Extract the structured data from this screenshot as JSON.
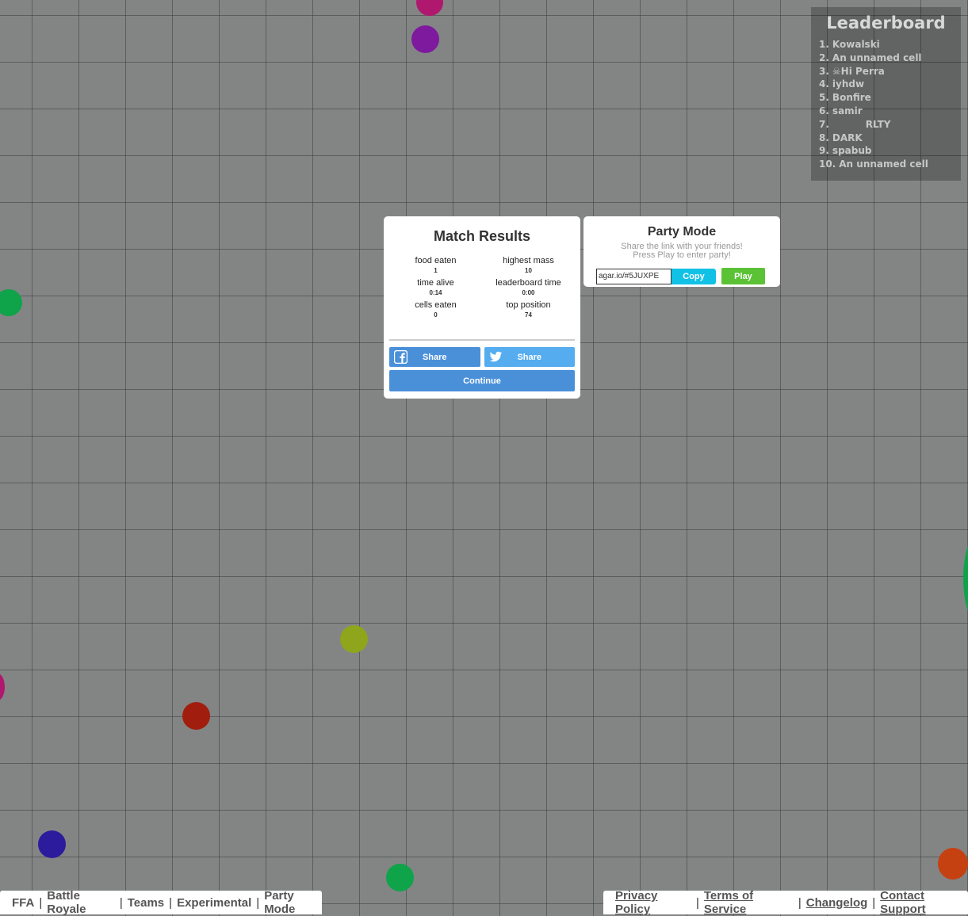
{
  "leaderboard": {
    "title": "Leaderboard",
    "entries": [
      {
        "rank": "1.",
        "name": "Kowalski"
      },
      {
        "rank": "2.",
        "name": "An unnamed cell"
      },
      {
        "rank": "3.",
        "name": "☠Hi Perra"
      },
      {
        "rank": "4.",
        "name": "iyhdw"
      },
      {
        "rank": "5.",
        "name": "Bonfire"
      },
      {
        "rank": "6.",
        "name": "samir"
      },
      {
        "rank": "7.",
        "name": "          RLTY"
      },
      {
        "rank": "8.",
        "name": "DARK"
      },
      {
        "rank": "9.",
        "name": "spabub"
      },
      {
        "rank": "10.",
        "name": "An unnamed cell"
      }
    ]
  },
  "match_results": {
    "title": "Match Results",
    "stats": {
      "food_eaten": {
        "label": "food eaten",
        "value": "1"
      },
      "highest_mass": {
        "label": "highest mass",
        "value": "10"
      },
      "time_alive": {
        "label": "time alive",
        "value": "0:14"
      },
      "leaderboard_time": {
        "label": "leaderboard time",
        "value": "0:00"
      },
      "cells_eaten": {
        "label": "cells eaten",
        "value": "0"
      },
      "top_position": {
        "label": "top position",
        "value": "74"
      }
    },
    "facebook_share_label": "Share",
    "twitter_share_label": "Share",
    "continue_label": "Continue"
  },
  "party_mode": {
    "title": "Party Mode",
    "line1": "Share the link with your friends!",
    "line2": "Press Play to enter party!",
    "link_value": "agar.io/#5JUXPE",
    "copy_label": "Copy",
    "play_label": "Play"
  },
  "footer_left": {
    "ffa": "FFA",
    "battle_royale": "Battle Royale",
    "teams": "Teams",
    "experimental": "Experimental",
    "party_mode": "Party Mode",
    "separator": "|"
  },
  "footer_right": {
    "privacy": "Privacy Policy",
    "terms": "Terms of Service",
    "changelog": "Changelog",
    "contact": "Contact Support",
    "separator": "|"
  },
  "colors": {
    "background": "#838585",
    "continue_button": "#4a90d9",
    "copy_button": "#12c1e6",
    "play_button": "#5bc236",
    "twitter_button": "#55acee"
  }
}
